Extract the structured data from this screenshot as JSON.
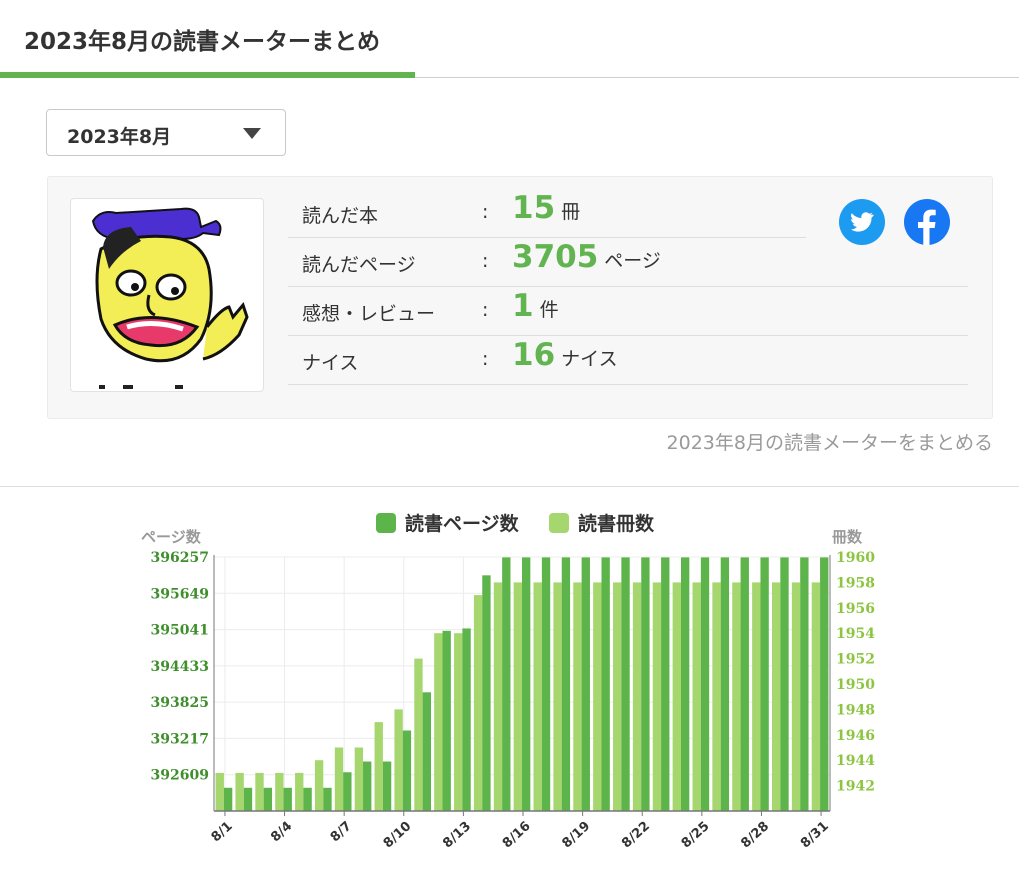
{
  "header": {
    "title": "2023年8月の読書メーターまとめ"
  },
  "month_select": {
    "value": "2023年8月"
  },
  "summary": {
    "rows": [
      {
        "label": "読んだ本",
        "colon": ":",
        "value": "15",
        "unit": "冊"
      },
      {
        "label": "読んだページ",
        "colon": ":",
        "value": "3705",
        "unit": "ページ"
      },
      {
        "label": "感想・レビュー",
        "colon": ":",
        "value": "1",
        "unit": "件"
      },
      {
        "label": "ナイス",
        "colon": ":",
        "value": "16",
        "unit": "ナイス"
      }
    ],
    "share": [
      "twitter-icon",
      "facebook-icon"
    ],
    "link": "2023年8月の読書メーターをまとめる"
  },
  "colors": {
    "accent": "#62b450",
    "pages": "#5db44b",
    "books": "#a6d66e",
    "twitter": "#1d9bf0",
    "facebook": "#1877f2"
  },
  "chart_data": {
    "type": "bar",
    "title": "",
    "grid": true,
    "legend_placement": "top-center",
    "y_left_label": "ページ数",
    "y_right_label": "冊数",
    "y_left_ticks": [
      "396257",
      "395649",
      "395041",
      "394433",
      "393825",
      "393217",
      "392609"
    ],
    "y_left_range": [
      392001,
      396257
    ],
    "y_right_ticks": [
      "1960",
      "1958",
      "1956",
      "1954",
      "1952",
      "1950",
      "1948",
      "1946",
      "1944",
      "1942"
    ],
    "y_right_range": [
      1940,
      1960
    ],
    "x_tick_labels": [
      "8/1",
      "8/4",
      "8/7",
      "8/10",
      "8/13",
      "8/16",
      "8/19",
      "8/22",
      "8/25",
      "8/28",
      "8/31"
    ],
    "categories": [
      "8/1",
      "8/2",
      "8/3",
      "8/4",
      "8/5",
      "8/6",
      "8/7",
      "8/8",
      "8/9",
      "8/10",
      "8/11",
      "8/12",
      "8/13",
      "8/14",
      "8/15",
      "8/16",
      "8/17",
      "8/18",
      "8/19",
      "8/20",
      "8/21",
      "8/22",
      "8/23",
      "8/24",
      "8/25",
      "8/26",
      "8/27",
      "8/28",
      "8/29",
      "8/30",
      "8/31"
    ],
    "series": [
      {
        "name": "読書ページ数",
        "axis": "left",
        "values": [
          392390,
          392390,
          392390,
          392390,
          392390,
          392390,
          392650,
          392830,
          392830,
          393350,
          393990,
          395020,
          395060,
          395950,
          396250,
          396250,
          396250,
          396250,
          396250,
          396250,
          396250,
          396250,
          396250,
          396250,
          396250,
          396250,
          396250,
          396250,
          396250,
          396250,
          396250
        ]
      },
      {
        "name": "読書冊数",
        "axis": "right",
        "values": [
          1943,
          1943,
          1943,
          1943,
          1943,
          1944,
          1945,
          1945,
          1947,
          1948,
          1952,
          1954,
          1954,
          1957,
          1958,
          1958,
          1958,
          1958,
          1958,
          1958,
          1958,
          1958,
          1958,
          1958,
          1958,
          1958,
          1958,
          1958,
          1958,
          1958,
          1958
        ]
      }
    ]
  }
}
